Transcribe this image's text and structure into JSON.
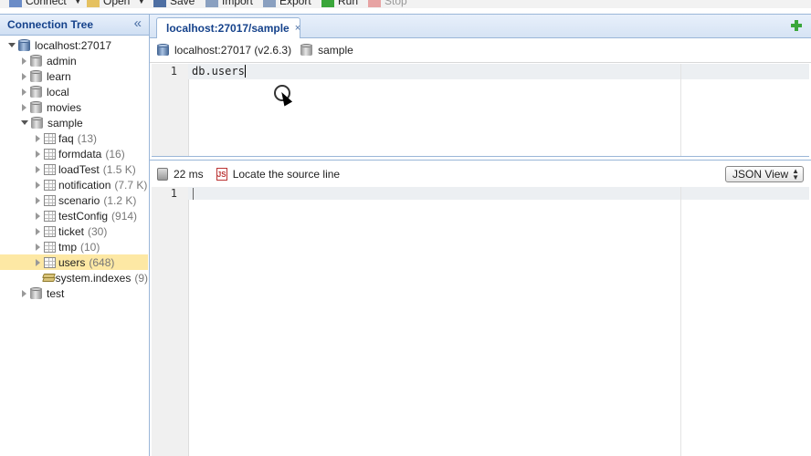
{
  "toolbar": {
    "items": [
      "Connect",
      "Open",
      "Save",
      "Import",
      "Export",
      "Run",
      "Stop"
    ]
  },
  "connection_tree": {
    "title": "Connection Tree",
    "server": "localhost:27017",
    "databases": [
      {
        "name": "admin"
      },
      {
        "name": "learn"
      },
      {
        "name": "local"
      },
      {
        "name": "movies"
      },
      {
        "name": "sample"
      },
      {
        "name": "test"
      }
    ],
    "collections": [
      {
        "name": "faq",
        "count": "(13)"
      },
      {
        "name": "formdata",
        "count": "(16)"
      },
      {
        "name": "loadTest",
        "count": "(1.5 K)"
      },
      {
        "name": "notification",
        "count": "(7.7 K)"
      },
      {
        "name": "scenario",
        "count": "(1.2 K)"
      },
      {
        "name": "testConfig",
        "count": "(914)"
      },
      {
        "name": "ticket",
        "count": "(30)"
      },
      {
        "name": "tmp",
        "count": "(10)"
      },
      {
        "name": "users",
        "count": "(648)"
      },
      {
        "name": "system.indexes",
        "count": "(9)"
      }
    ]
  },
  "tab": {
    "label": "localhost:27017/sample",
    "close": "×"
  },
  "context": {
    "server": "localhost:27017 (v2.6.3)",
    "database": "sample"
  },
  "editor": {
    "line_number": "1",
    "code": "db.users"
  },
  "result": {
    "time": "22 ms",
    "locate": "Locate the source line",
    "js_badge": "JS",
    "view": "JSON View",
    "line_number": "1"
  },
  "colors": {
    "header_text": "#15428b",
    "selected_row": "#fde8a4",
    "border": "#9ab6d8"
  }
}
